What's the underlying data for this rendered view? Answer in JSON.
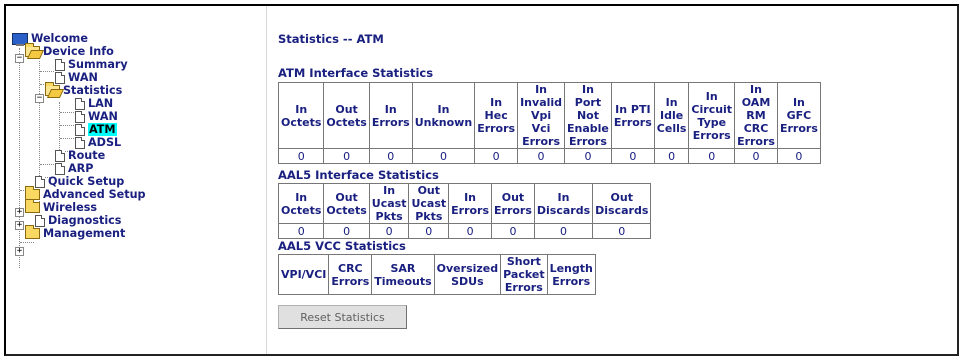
{
  "tree": {
    "welcome": "Welcome",
    "device_info": "Device Info",
    "summary": "Summary",
    "wan": "WAN",
    "statistics": "Statistics",
    "stat_lan": "LAN",
    "stat_wan": "WAN",
    "stat_atm": "ATM",
    "stat_adsl": "ADSL",
    "route": "Route",
    "arp": "ARP",
    "quick_setup": "Quick Setup",
    "advanced_setup": "Advanced Setup",
    "wireless": "Wireless",
    "diagnostics": "Diagnostics",
    "management": "Management",
    "selected": "ATM",
    "selected_color": "#00ffff"
  },
  "page": {
    "title": "Statistics -- ATM",
    "text_color": "#1a2080"
  },
  "atm_interface": {
    "title": "ATM Interface Statistics",
    "headers": [
      [
        "In",
        "Octets"
      ],
      [
        "Out",
        "Octets"
      ],
      [
        "In",
        "Errors"
      ],
      [
        "In",
        "Unknown"
      ],
      [
        "In Hec",
        "Errors"
      ],
      [
        "In Invalid",
        "Vpi Vci",
        "Errors"
      ],
      [
        "In Port",
        "Not Enable",
        "Errors"
      ],
      [
        "In PTI",
        "Errors"
      ],
      [
        "In",
        "Idle",
        "Cells"
      ],
      [
        "In Circuit",
        "Type",
        "Errors"
      ],
      [
        "In OAM",
        "RM CRC",
        "Errors"
      ],
      [
        "In GFC",
        "Errors"
      ]
    ],
    "values": [
      "0",
      "0",
      "0",
      "0",
      "0",
      "0",
      "0",
      "0",
      "0",
      "0",
      "0",
      "0"
    ]
  },
  "aal5_interface": {
    "title": "AAL5 Interface Statistics",
    "headers": [
      "In Octets",
      "Out Octets",
      "In Ucast Pkts",
      "Out Ucast Pkts",
      "In Errors",
      "Out Errors",
      "In Discards",
      "Out Discards"
    ],
    "values": [
      "0",
      "0",
      "0",
      "0",
      "0",
      "0",
      "0",
      "0"
    ]
  },
  "aal5_vcc": {
    "title": "AAL5 VCC Statistics",
    "headers": [
      "VPI/VCI",
      "CRC Errors",
      "SAR Timeouts",
      "Oversized SDUs",
      "Short Packet Errors",
      "Length Errors"
    ]
  },
  "reset_button": "Reset Statistics"
}
